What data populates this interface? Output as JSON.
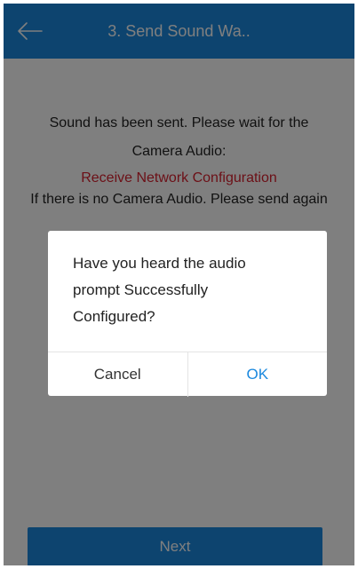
{
  "app_bar": {
    "title": "3. Send Sound Wa..",
    "back_icon": "arrow-left-icon"
  },
  "content": {
    "line1": "Sound has been sent. Please wait for the",
    "line2": "Camera Audio:",
    "line3": "Receive Network Configuration",
    "line4": "If there is no Camera Audio. Please send again"
  },
  "dialog": {
    "message_lines": [
      "Have you heard the audio",
      "prompt Successfully",
      "Configured?"
    ],
    "cancel_label": "Cancel",
    "ok_label": "OK"
  },
  "footer": {
    "next_label": "Next"
  },
  "colors": {
    "accent": "#1a88de",
    "highlight_text": "#d8212f",
    "scrim": "rgba(0,0,0,0.5)"
  }
}
